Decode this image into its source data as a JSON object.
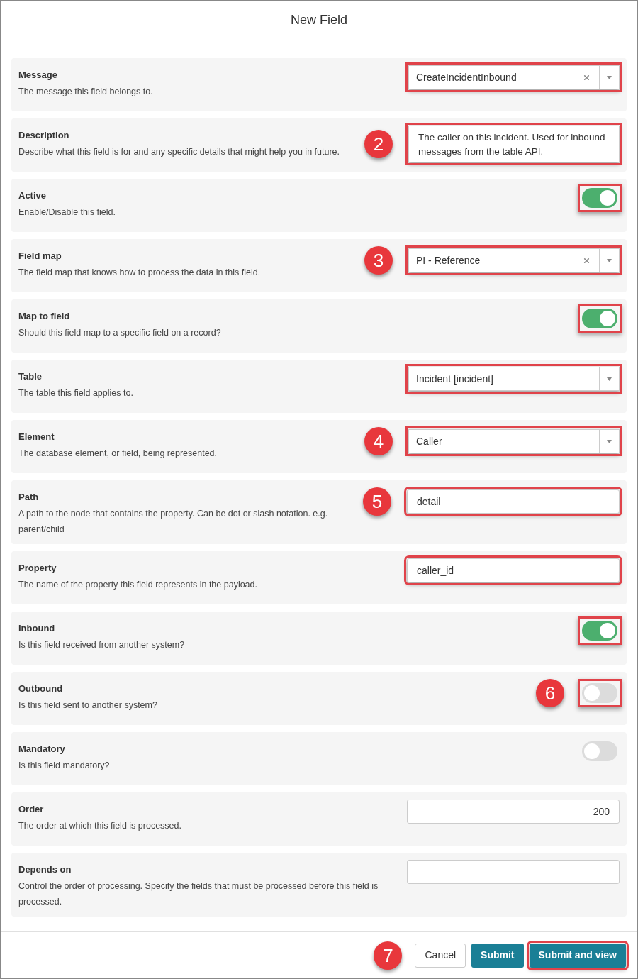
{
  "dialog": {
    "title": "New Field"
  },
  "fields": [
    {
      "kind": "select",
      "label": "Message",
      "description": "The message this field belongs to.",
      "value": "CreateIncidentInbound",
      "clearable": true,
      "highlighted": true
    },
    {
      "kind": "textarea",
      "label": "Description",
      "description": "Describe what this field is for and any specific details that might help you in future.",
      "value": "The caller on this incident.  Used for inbound messages from the table API.",
      "callout": "2",
      "highlighted": true
    },
    {
      "kind": "toggle",
      "label": "Active",
      "description": "Enable/Disable this field.",
      "on": true,
      "highlighted": true
    },
    {
      "kind": "select",
      "label": "Field map",
      "description": "The field map that knows how to process the data in this field.",
      "value": "PI - Reference",
      "clearable": true,
      "callout": "3",
      "highlighted": true
    },
    {
      "kind": "toggle",
      "label": "Map to field",
      "description": "Should this field map to a specific field on a record?",
      "on": true,
      "highlighted": true
    },
    {
      "kind": "select",
      "label": "Table",
      "description": "The table this field applies to.",
      "value": "Incident [incident]",
      "clearable": false,
      "highlighted": true
    },
    {
      "kind": "select",
      "label": "Element",
      "description": "The database element, or field, being represented.",
      "value": "Caller",
      "clearable": false,
      "callout": "4",
      "highlighted": true
    },
    {
      "kind": "text",
      "label": "Path",
      "description": "A path to the node that contains the property. Can be dot or slash notation. e.g. parent/child",
      "value": "detail",
      "callout": "5",
      "highlighted": true
    },
    {
      "kind": "text",
      "label": "Property",
      "description": "The name of the property this field represents in the payload.",
      "value": "caller_id",
      "highlighted": true
    },
    {
      "kind": "toggle",
      "label": "Inbound",
      "description": "Is this field received from another system?",
      "on": true,
      "highlighted": true
    },
    {
      "kind": "toggle",
      "label": "Outbound",
      "description": "Is this field sent to another system?",
      "on": false,
      "callout": "6",
      "highlighted": true
    },
    {
      "kind": "toggle",
      "label": "Mandatory",
      "description": "Is this field mandatory?",
      "on": false,
      "highlighted": false
    },
    {
      "kind": "number",
      "label": "Order",
      "description": "The order at which this field is processed.",
      "value": "200",
      "highlighted": false
    },
    {
      "kind": "text",
      "label": "Depends on",
      "description": "Control the order of processing. Specify the fields that must be processed before this field is processed.",
      "highlighted": false
    }
  ],
  "footer": {
    "callout": "7",
    "buttons": [
      {
        "kind": "secondary",
        "label": "Cancel",
        "highlighted": false
      },
      {
        "kind": "primary",
        "label": "Submit",
        "highlighted": false
      },
      {
        "kind": "primary",
        "label": "Submit and view",
        "highlighted": true
      }
    ]
  }
}
